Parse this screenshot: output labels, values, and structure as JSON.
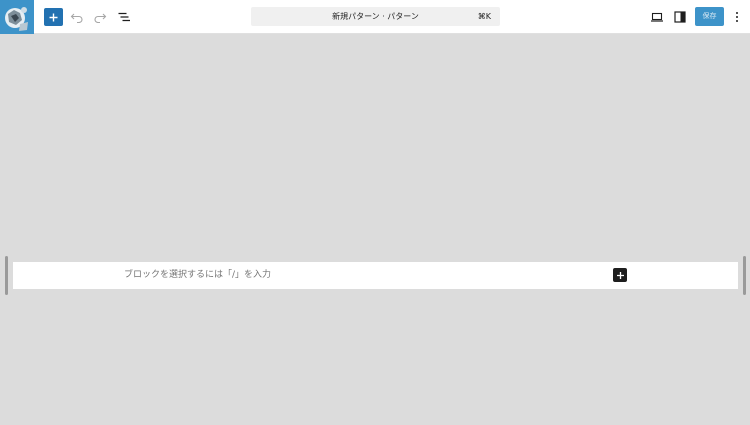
{
  "toolbar": {
    "logo_icon": "site-logo-icon",
    "add_icon": "plus-icon",
    "undo_icon": "undo-icon",
    "redo_icon": "redo-icon",
    "outline_icon": "document-overview-icon",
    "preview_icon": "laptop-icon",
    "settings_icon": "sidebar-icon",
    "options_icon": "more-vertical-icon",
    "save_label": "保存"
  },
  "command_bar": {
    "title": "新規パターン · パターン",
    "shortcut": "⌘K"
  },
  "editor": {
    "placeholder": "ブロックを選択するには「/」を入力",
    "inserter_icon": "plus-icon"
  },
  "colors": {
    "accent": "#2271b1",
    "save_bg": "#3d93c9",
    "canvas_bg": "#dcdcdc"
  }
}
